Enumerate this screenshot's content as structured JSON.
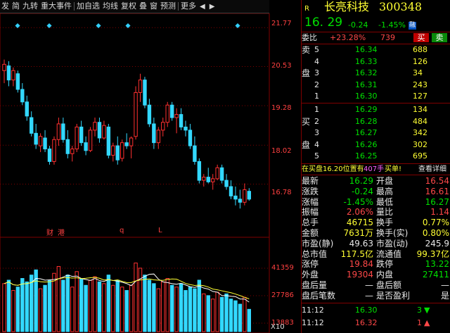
{
  "toolbar": {
    "items": [
      "发",
      "简",
      "九转",
      "重大事件",
      "加自选",
      "均线",
      "复权",
      "叠",
      "窗",
      "预测",
      "更多"
    ]
  },
  "chart": {
    "price_labels": [
      "21.77",
      "20.53",
      "19.28",
      "18.02",
      "16.78"
    ],
    "volume_labels": [
      "41359",
      "27786",
      "13883"
    ],
    "volume_unit": "X10",
    "markers": [
      "财",
      "港",
      "q",
      "L"
    ]
  },
  "quote": {
    "badge": "R",
    "name": "长亮科技",
    "code": "300348",
    "price": "16. 29",
    "change": "-0.24",
    "change_pct": "-1.45%",
    "exchange": "融",
    "weibi_label": "委比",
    "weibi_value": "+23.28%",
    "weicha_value": "739",
    "buy_btn": "买",
    "sell_btn": "卖"
  },
  "sell_orders": [
    {
      "side": "卖",
      "idx": "5",
      "price": "16.34",
      "vol": "688"
    },
    {
      "side": "",
      "idx": "4",
      "price": "16.33",
      "vol": "126"
    },
    {
      "side": "盘",
      "idx": "3",
      "price": "16.32",
      "vol": "34"
    },
    {
      "side": "",
      "idx": "2",
      "price": "16.31",
      "vol": "243"
    },
    {
      "side": "",
      "idx": "1",
      "price": "16.30",
      "vol": "127"
    }
  ],
  "buy_orders": [
    {
      "side": "",
      "idx": "1",
      "price": "16.29",
      "vol": "134"
    },
    {
      "side": "买",
      "idx": "2",
      "price": "16.28",
      "vol": "484"
    },
    {
      "side": "",
      "idx": "3",
      "price": "16.27",
      "vol": "342"
    },
    {
      "side": "盘",
      "idx": "4",
      "price": "16.26",
      "vol": "302"
    },
    {
      "side": "",
      "idx": "5",
      "price": "16.25",
      "vol": "695"
    }
  ],
  "notice": {
    "prefix": "在买盘16.20位置有",
    "amount": "407手",
    "action": "买单!",
    "link": "查看详细"
  },
  "stats": [
    {
      "l1": "最新",
      "v1": "16.29",
      "c1": "green",
      "l2": "开盘",
      "v2": "16.54",
      "c2": "red"
    },
    {
      "l1": "涨跌",
      "v1": "-0.24",
      "c1": "green",
      "l2": "最高",
      "v2": "16.61",
      "c2": "red"
    },
    {
      "l1": "涨幅",
      "v1": "-1.45%",
      "c1": "green",
      "l2": "最低",
      "v2": "16.27",
      "c2": "green"
    },
    {
      "l1": "振幅",
      "v1": "2.06%",
      "c1": "red",
      "l2": "量比",
      "v2": "1.14",
      "c2": "red"
    },
    {
      "l1": "总手",
      "v1": "46715",
      "c1": "yellow",
      "l2": "换手",
      "v2": "0.77%",
      "c2": "yellow"
    },
    {
      "l1": "金额",
      "v1": "7631万",
      "c1": "yellow",
      "l2": "换手(实)",
      "v2": "0.80%",
      "c2": "yellow"
    },
    {
      "l1": "市盈(静)",
      "v1": "49.63",
      "c1": "white",
      "l2": "市盈(动)",
      "v2": "245.9",
      "c2": "white"
    },
    {
      "l1": "总市值",
      "v1": "117.5亿",
      "c1": "yellow",
      "l2": "流通值",
      "v2": "99.37亿",
      "c2": "yellow"
    },
    {
      "l1": "涨停",
      "v1": "19.84",
      "c1": "red",
      "l2": "跌停",
      "v2": "13.22",
      "c2": "green"
    },
    {
      "l1": "外盘",
      "v1": "19304",
      "c1": "red",
      "l2": "内盘",
      "v2": "27411",
      "c2": "green"
    },
    {
      "l1": "盘后量",
      "v1": "—",
      "c1": "white",
      "l2": "盘后额",
      "v2": "—",
      "c2": "white"
    },
    {
      "l1": "盘后笔数",
      "v1": "—",
      "c1": "white",
      "l2": "是否盈利",
      "v2": "是",
      "c2": "white"
    }
  ],
  "ticks": [
    {
      "time": "11:12",
      "price": "16.30",
      "vol": "3",
      "dir": "down",
      "color": "green"
    },
    {
      "time": "11:12",
      "price": "16.32",
      "vol": "1",
      "dir": "up",
      "color": "red"
    }
  ],
  "candles": [
    {
      "o": 20.4,
      "h": 20.75,
      "l": 20.0,
      "c": 20.6
    },
    {
      "o": 20.55,
      "h": 20.7,
      "l": 19.9,
      "c": 20.1
    },
    {
      "o": 20.1,
      "h": 20.5,
      "l": 19.9,
      "c": 20.4
    },
    {
      "o": 20.3,
      "h": 20.4,
      "l": 19.7,
      "c": 19.8
    },
    {
      "o": 19.8,
      "h": 20.0,
      "l": 19.3,
      "c": 19.4
    },
    {
      "o": 19.4,
      "h": 19.6,
      "l": 18.8,
      "c": 18.95
    },
    {
      "o": 18.9,
      "h": 19.1,
      "l": 18.3,
      "c": 18.4
    },
    {
      "o": 18.4,
      "h": 18.7,
      "l": 17.9,
      "c": 18.05
    },
    {
      "o": 18.0,
      "h": 18.4,
      "l": 17.8,
      "c": 18.3
    },
    {
      "o": 18.25,
      "h": 18.5,
      "l": 17.8,
      "c": 17.9
    },
    {
      "o": 17.9,
      "h": 18.0,
      "l": 17.4,
      "c": 17.5
    },
    {
      "o": 17.5,
      "h": 18.3,
      "l": 17.4,
      "c": 18.2
    },
    {
      "o": 18.2,
      "h": 18.9,
      "l": 18.0,
      "c": 18.7
    },
    {
      "o": 18.7,
      "h": 18.9,
      "l": 18.1,
      "c": 18.2
    },
    {
      "o": 18.2,
      "h": 18.5,
      "l": 17.6,
      "c": 17.75
    },
    {
      "o": 17.75,
      "h": 18.0,
      "l": 17.5,
      "c": 17.9
    },
    {
      "o": 17.9,
      "h": 18.7,
      "l": 17.8,
      "c": 18.6
    },
    {
      "o": 18.6,
      "h": 18.8,
      "l": 18.0,
      "c": 18.1
    },
    {
      "o": 18.1,
      "h": 18.3,
      "l": 17.7,
      "c": 17.85
    },
    {
      "o": 17.85,
      "h": 18.6,
      "l": 17.8,
      "c": 18.5
    },
    {
      "o": 18.5,
      "h": 18.9,
      "l": 18.3,
      "c": 18.75
    },
    {
      "o": 18.75,
      "h": 18.9,
      "l": 18.1,
      "c": 18.25
    },
    {
      "o": 18.25,
      "h": 18.8,
      "l": 18.2,
      "c": 18.65
    },
    {
      "o": 18.6,
      "h": 18.7,
      "l": 17.6,
      "c": 17.7
    },
    {
      "o": 17.7,
      "h": 18.1,
      "l": 17.5,
      "c": 18.0
    },
    {
      "o": 18.0,
      "h": 18.3,
      "l": 17.4,
      "c": 17.55
    },
    {
      "o": 17.6,
      "h": 18.2,
      "l": 17.5,
      "c": 18.1
    },
    {
      "o": 18.1,
      "h": 18.4,
      "l": 17.9,
      "c": 18.0
    },
    {
      "o": 18.0,
      "h": 18.3,
      "l": 17.6,
      "c": 18.25
    },
    {
      "o": 18.3,
      "h": 19.9,
      "l": 18.2,
      "c": 19.7
    },
    {
      "o": 19.7,
      "h": 20.3,
      "l": 19.4,
      "c": 20.1
    },
    {
      "o": 20.1,
      "h": 20.2,
      "l": 19.2,
      "c": 19.3
    },
    {
      "o": 19.3,
      "h": 19.5,
      "l": 18.6,
      "c": 18.7
    },
    {
      "o": 18.7,
      "h": 18.9,
      "l": 17.9,
      "c": 18.1
    },
    {
      "o": 18.1,
      "h": 18.6,
      "l": 17.9,
      "c": 18.5
    },
    {
      "o": 18.5,
      "h": 18.9,
      "l": 18.3,
      "c": 18.75
    },
    {
      "o": 18.75,
      "h": 19.4,
      "l": 18.6,
      "c": 19.3
    },
    {
      "o": 19.3,
      "h": 19.4,
      "l": 18.8,
      "c": 18.9
    },
    {
      "o": 18.9,
      "h": 19.2,
      "l": 18.4,
      "c": 19.0
    },
    {
      "o": 19.0,
      "h": 19.2,
      "l": 18.5,
      "c": 18.6
    },
    {
      "o": 18.6,
      "h": 18.8,
      "l": 18.3,
      "c": 18.5
    },
    {
      "o": 18.5,
      "h": 18.7,
      "l": 17.9,
      "c": 18.0
    },
    {
      "o": 18.0,
      "h": 18.3,
      "l": 17.4,
      "c": 17.5
    },
    {
      "o": 17.5,
      "h": 17.6,
      "l": 16.8,
      "c": 16.9
    },
    {
      "o": 16.9,
      "h": 17.1,
      "l": 16.7,
      "c": 17.0
    },
    {
      "o": 17.0,
      "h": 17.3,
      "l": 16.8,
      "c": 16.85
    },
    {
      "o": 16.85,
      "h": 17.1,
      "l": 16.6,
      "c": 16.95
    },
    {
      "o": 16.95,
      "h": 17.4,
      "l": 16.9,
      "c": 17.3
    },
    {
      "o": 17.3,
      "h": 17.4,
      "l": 16.8,
      "c": 16.9
    },
    {
      "o": 16.9,
      "h": 17.1,
      "l": 16.6,
      "c": 16.7
    },
    {
      "o": 16.7,
      "h": 16.9,
      "l": 16.3,
      "c": 16.4
    },
    {
      "o": 16.4,
      "h": 16.7,
      "l": 16.1,
      "c": 16.3
    },
    {
      "o": 16.3,
      "h": 16.6,
      "l": 16.0,
      "c": 16.2
    },
    {
      "o": 16.2,
      "h": 16.8,
      "l": 16.1,
      "c": 16.6
    },
    {
      "o": 16.55,
      "h": 16.65,
      "l": 16.25,
      "c": 16.3
    }
  ],
  "volumes": [
    28000,
    30000,
    24000,
    26000,
    31000,
    29000,
    33000,
    36000,
    25000,
    27000,
    30000,
    34000,
    38000,
    30000,
    33000,
    26000,
    35000,
    31000,
    27000,
    30000,
    32000,
    29000,
    28000,
    33000,
    27000,
    30000,
    26000,
    24000,
    27000,
    40000,
    37000,
    33000,
    30000,
    28000,
    25000,
    29000,
    31000,
    27000,
    26000,
    28000,
    24000,
    26000,
    25000,
    30000,
    22000,
    21000,
    19000,
    23000,
    20000,
    22000,
    19000,
    18000,
    16000,
    20000,
    13000
  ]
}
